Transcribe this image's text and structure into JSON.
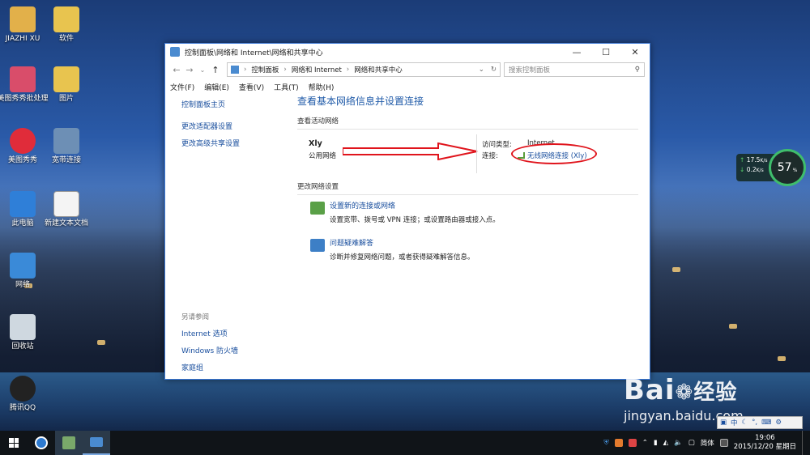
{
  "desktop": {
    "icons": [
      {
        "label": "JIAZHI XU"
      },
      {
        "label": "软件"
      },
      {
        "label": "美图秀秀批处理"
      },
      {
        "label": "图片"
      },
      {
        "label": "美图秀秀"
      },
      {
        "label": "宽带连接"
      },
      {
        "label": "此电脑"
      },
      {
        "label": "新建文本文档"
      },
      {
        "label": "网络"
      },
      {
        "label": "回收站"
      },
      {
        "label": "腾讯QQ"
      }
    ]
  },
  "window": {
    "title": "控制面板\\网络和 Internet\\网络和共享中心",
    "min_icon": "minimize-icon",
    "max_icon": "maximize-icon",
    "close_icon": "close-icon",
    "breadcrumbs": [
      "控制面板",
      "网络和 Internet",
      "网络和共享中心"
    ],
    "search_placeholder": "搜索控制面板",
    "menu": [
      "文件(F)",
      "编辑(E)",
      "查看(V)",
      "工具(T)",
      "帮助(H)"
    ],
    "sidebar": {
      "links": [
        "控制面板主页",
        "更改适配器设置",
        "更改高级共享设置"
      ],
      "see_also_label": "另请参阅",
      "see_also": [
        "Internet 选项",
        "Windows 防火墙",
        "家庭组"
      ]
    },
    "main": {
      "heading": "查看基本网络信息并设置连接",
      "active_networks_label": "查看活动网络",
      "network_name": "Xly",
      "network_type": "公用网络",
      "access_type_label": "访问类型:",
      "access_type_value": "Internet",
      "connection_label": "连接:",
      "connection_value": "无线网络连接 (Xly)",
      "change_settings_label": "更改网络设置",
      "items": [
        {
          "link": "设置新的连接或网络",
          "desc": "设置宽带、拨号或 VPN 连接；或设置路由器或接入点。"
        },
        {
          "link": "问题疑难解答",
          "desc": "诊断并修复网络问题，或者获得疑难解答信息。"
        }
      ]
    }
  },
  "widget": {
    "up_speed": "17.5",
    "up_unit": "K/s",
    "down_speed": "0.2",
    "down_unit": "K/s",
    "percent": "57",
    "percent_sign": "%"
  },
  "watermark": {
    "brand": "Bai",
    "brand2": "经验",
    "url": "jingyan.baidu.com"
  },
  "ime": {
    "lang": "中"
  },
  "taskbar": {
    "ime_label": "简体",
    "time": "19:06",
    "date": "2015/12/20 星期日"
  },
  "colors": {
    "accent": "#1f5aa8",
    "link": "#1a4f9e",
    "annotation": "#e0141c"
  }
}
